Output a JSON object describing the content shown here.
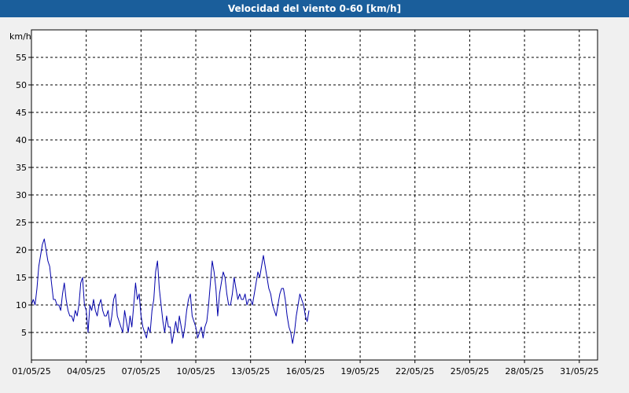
{
  "chart_data": {
    "type": "line",
    "title": "Velocidad del viento 0-60 [km/h]",
    "ylabel": "km/h",
    "xlabel": "",
    "ylim": [
      0,
      60
    ],
    "y_ticks": [
      5,
      10,
      15,
      20,
      25,
      30,
      35,
      40,
      45,
      50,
      55
    ],
    "xlim_days": [
      1,
      32
    ],
    "x_ticks": [
      {
        "day": 1,
        "label": "01/05/25"
      },
      {
        "day": 4,
        "label": "04/05/25"
      },
      {
        "day": 7,
        "label": "07/05/25"
      },
      {
        "day": 10,
        "label": "10/05/25"
      },
      {
        "day": 13,
        "label": "13/05/25"
      },
      {
        "day": 16,
        "label": "16/05/25"
      },
      {
        "day": 19,
        "label": "19/05/25"
      },
      {
        "day": 22,
        "label": "22/05/25"
      },
      {
        "day": 25,
        "label": "25/05/25"
      },
      {
        "day": 28,
        "label": "28/05/25"
      },
      {
        "day": 31,
        "label": "31/05/25"
      }
    ],
    "grid": true,
    "series": [
      {
        "color": "#0000aa",
        "x": [
          1.0,
          1.1,
          1.2,
          1.3,
          1.4,
          1.5,
          1.6,
          1.7,
          1.8,
          1.9,
          2.0,
          2.1,
          2.2,
          2.3,
          2.4,
          2.5,
          2.6,
          2.7,
          2.8,
          2.9,
          3.0,
          3.1,
          3.2,
          3.3,
          3.4,
          3.5,
          3.6,
          3.7,
          3.8,
          3.9,
          4.0,
          4.1,
          4.2,
          4.3,
          4.4,
          4.5,
          4.6,
          4.7,
          4.8,
          4.9,
          5.0,
          5.1,
          5.2,
          5.3,
          5.4,
          5.5,
          5.6,
          5.7,
          5.8,
          5.9,
          6.0,
          6.1,
          6.2,
          6.3,
          6.4,
          6.5,
          6.6,
          6.7,
          6.8,
          6.9,
          7.0,
          7.1,
          7.2,
          7.3,
          7.4,
          7.5,
          7.6,
          7.7,
          7.8,
          7.9,
          8.0,
          8.1,
          8.2,
          8.3,
          8.4,
          8.5,
          8.6,
          8.7,
          8.8,
          8.9,
          9.0,
          9.1,
          9.2,
          9.3,
          9.4,
          9.5,
          9.6,
          9.7,
          9.8,
          9.9,
          10.0,
          10.1,
          10.2,
          10.3,
          10.4,
          10.5,
          10.6,
          10.7,
          10.8,
          10.9,
          11.0,
          11.1,
          11.2,
          11.3,
          11.4,
          11.5,
          11.6,
          11.7,
          11.8,
          11.9,
          12.0,
          12.1,
          12.2,
          12.3,
          12.4,
          12.5,
          12.6,
          12.7,
          12.8,
          12.9,
          13.0,
          13.1,
          13.2,
          13.3,
          13.4,
          13.5,
          13.6,
          13.7,
          13.8,
          13.9,
          14.0,
          14.1,
          14.2,
          14.3,
          14.4,
          14.5,
          14.6,
          14.7,
          14.8,
          14.9,
          15.0,
          15.1,
          15.2,
          15.3,
          15.4,
          15.5,
          15.6,
          15.7,
          15.8,
          15.9,
          16.0,
          16.1,
          16.2
        ],
        "y": [
          10,
          11,
          10,
          13,
          17,
          19,
          21,
          22,
          20,
          18,
          17,
          14,
          11,
          11,
          10,
          10,
          9,
          12,
          14,
          11,
          9,
          8,
          8,
          7,
          9,
          8,
          10,
          14,
          15,
          10,
          9,
          5,
          10,
          9,
          11,
          9,
          8,
          10,
          11,
          9,
          8,
          8,
          9,
          6,
          8,
          11,
          12,
          8,
          7,
          6,
          5,
          9,
          7,
          5,
          8,
          6,
          10,
          14,
          11,
          12,
          8,
          6,
          5,
          4,
          6,
          5,
          9,
          11,
          16,
          18,
          13,
          10,
          7,
          5,
          8,
          6,
          6,
          3,
          5,
          7,
          5,
          8,
          6,
          4,
          6,
          9,
          11,
          12,
          8,
          7,
          6,
          4,
          5,
          6,
          4,
          6,
          7,
          10,
          14,
          18,
          16,
          13,
          8,
          12,
          14,
          16,
          15,
          12,
          10,
          10,
          12,
          15,
          13,
          11,
          12,
          11,
          11,
          12,
          10,
          11,
          11,
          10,
          12,
          14,
          16,
          15,
          17,
          19,
          17,
          15,
          13,
          12,
          10,
          9,
          8,
          10,
          12,
          13,
          13,
          11,
          8,
          6,
          5,
          3,
          5,
          8,
          10,
          12,
          11,
          10,
          8,
          7,
          9
        ]
      }
    ]
  }
}
